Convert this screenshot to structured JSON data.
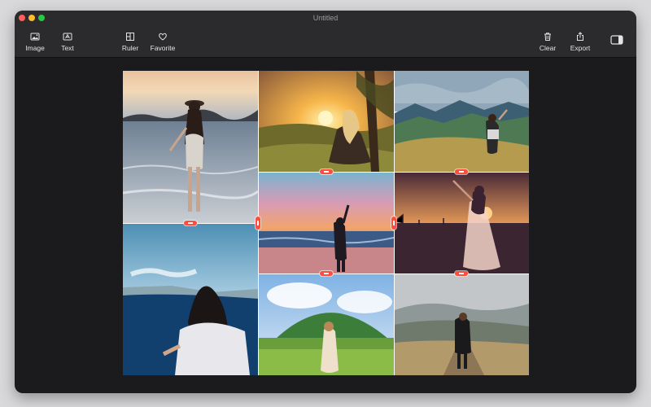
{
  "window": {
    "title": "Untitled"
  },
  "toolbar": {
    "image_label": "Image",
    "text_label": "Text",
    "ruler_label": "Ruler",
    "favorite_label": "Favorite",
    "clear_label": "Clear",
    "export_label": "Export"
  },
  "icons": [
    "image-icon",
    "text-box-icon",
    "ruler-icon",
    "heart-icon",
    "trash-icon",
    "share-icon",
    "sidebar-toggle-icon"
  ],
  "collage": {
    "tiles": [
      {
        "name": "beach-sunset-hat"
      },
      {
        "name": "sunset-meadow"
      },
      {
        "name": "mountain-valley"
      },
      {
        "name": "pink-sunset-sea"
      },
      {
        "name": "golden-field-dress"
      },
      {
        "name": "cliff-sea-view"
      },
      {
        "name": "green-hill-field"
      },
      {
        "name": "misty-path"
      }
    ]
  },
  "colors": {
    "window_bg": "#1b1b1d",
    "titlebar_bg": "#2b2b2d",
    "handle": "#ff4d3d"
  }
}
